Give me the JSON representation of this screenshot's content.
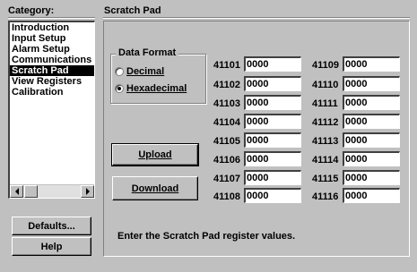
{
  "category": {
    "header": "Category:",
    "items": [
      {
        "label": "Introduction",
        "selected": false
      },
      {
        "label": "Input Setup",
        "selected": false
      },
      {
        "label": "Alarm Setup",
        "selected": false
      },
      {
        "label": "Communications",
        "selected": false
      },
      {
        "label": "Scratch Pad",
        "selected": true
      },
      {
        "label": "View Registers",
        "selected": false
      },
      {
        "label": "Calibration",
        "selected": false
      }
    ]
  },
  "page": {
    "title": "Scratch Pad"
  },
  "data_format": {
    "title": "Data Format",
    "options": [
      {
        "label": "Decimal",
        "checked": false
      },
      {
        "label": "Hexadecimal",
        "checked": true
      }
    ]
  },
  "buttons": {
    "upload": "Upload",
    "download": "Download",
    "defaults": "Defaults...",
    "help": "Help"
  },
  "registers": {
    "left": [
      {
        "label": "41101",
        "value": "0000"
      },
      {
        "label": "41102",
        "value": "0000"
      },
      {
        "label": "41103",
        "value": "0000"
      },
      {
        "label": "41104",
        "value": "0000"
      },
      {
        "label": "41105",
        "value": "0000"
      },
      {
        "label": "41106",
        "value": "0000"
      },
      {
        "label": "41107",
        "value": "0000"
      },
      {
        "label": "41108",
        "value": "0000"
      }
    ],
    "right": [
      {
        "label": "41109",
        "value": "0000"
      },
      {
        "label": "41110",
        "value": "0000"
      },
      {
        "label": "41111",
        "value": "0000"
      },
      {
        "label": "41112",
        "value": "0000"
      },
      {
        "label": "41113",
        "value": "0000"
      },
      {
        "label": "41114",
        "value": "0000"
      },
      {
        "label": "41115",
        "value": "0000"
      },
      {
        "label": "41116",
        "value": "0000"
      }
    ]
  },
  "status": "Enter the Scratch Pad register values."
}
